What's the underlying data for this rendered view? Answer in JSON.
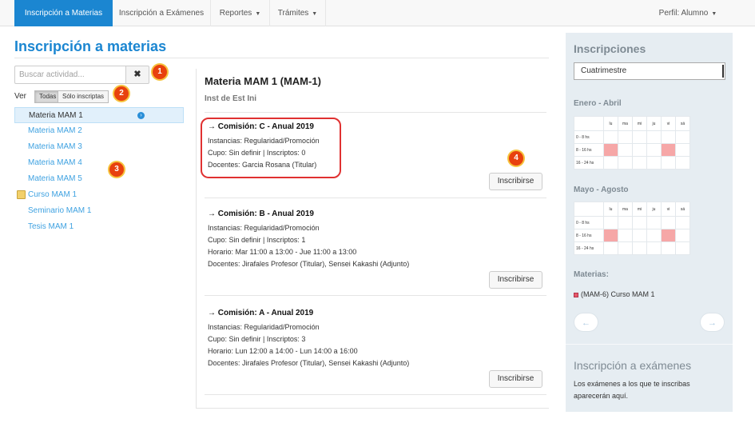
{
  "navbar": {
    "tabs": [
      {
        "label": "Inscripción a Materias",
        "active": true
      },
      {
        "label": "Inscripción a Exámenes"
      },
      {
        "label": "Reportes"
      },
      {
        "label": "Trámites"
      }
    ],
    "profile": "Perfil: Alumno"
  },
  "page_title": "Inscripción a materias",
  "search": {
    "placeholder": "Buscar actividad...",
    "value": ""
  },
  "clear_icon": "✖",
  "filter": {
    "label": "Ver",
    "options": [
      "Todas",
      "Sólo inscriptas"
    ],
    "selected": "Todas"
  },
  "badges": [
    "1",
    "2",
    "3",
    "4"
  ],
  "activities": [
    {
      "label": "Materia MAM 1",
      "selected": true,
      "icon": "info-icon"
    },
    {
      "label": "Materia MAM 2"
    },
    {
      "label": "Materia MAM 3"
    },
    {
      "label": "Materia MAM 4"
    },
    {
      "label": "Materia MAM 5"
    },
    {
      "label": "Curso MAM 1",
      "icon": "pencil-icon"
    },
    {
      "label": "Seminario MAM 1"
    },
    {
      "label": "Tesis MAM 1"
    }
  ],
  "materia": {
    "title": "Materia MAM 1 (MAM-1)",
    "subtitle": "Inst de Est Ini",
    "comisiones": [
      {
        "title": "→ Comisión: C - Anual 2019",
        "lines": [
          "Instancias: Regularidad/Promoción",
          "Cupo: Sin definir | Inscriptos: 0",
          "Docentes: Garcia Rosana (Titular)"
        ],
        "button": "Inscribirse"
      },
      {
        "title": "→ Comisión: B - Anual 2019",
        "lines": [
          "Instancias: Regularidad/Promoción",
          "Cupo: Sin definir | Inscriptos: 1",
          "Horario: Mar 11:00 a 13:00 - Jue 11:00 a 13:00",
          "Docentes: Jirafales Profesor (Titular), Sensei Kakashi (Adjunto)"
        ],
        "button": "Inscribirse"
      },
      {
        "title": "→ Comisión: A - Anual 2019",
        "lines": [
          "Instancias: Regularidad/Promoción",
          "Cupo: Sin definir | Inscriptos: 3",
          "Horario: Lun 12:00 a 14:00 - Lun 14:00 a 16:00",
          "Docentes: Jirafales Profesor (Titular), Sensei Kakashi (Adjunto)"
        ],
        "button": "Inscribirse"
      }
    ]
  },
  "sidebar": {
    "title": "Inscripciones",
    "period_select": "Cuatrimestre",
    "days": [
      "lu",
      "ma",
      "mi",
      "ju",
      "vi",
      "sá"
    ],
    "slots": [
      "0 - 8 hs",
      "8 - 16 hs",
      "16 - 24 hs"
    ],
    "periods": [
      {
        "label": "Enero - Abril",
        "busy": [
          [
            1,
            0
          ],
          [
            1,
            4
          ]
        ]
      },
      {
        "label": "Mayo - Agosto",
        "busy": [
          [
            1,
            0
          ],
          [
            1,
            4
          ]
        ]
      }
    ],
    "materias_label": "Materias:",
    "legend_item": "(MAM-6) Curso MAM 1",
    "legend_color": "#e55a6a",
    "prev": "←",
    "next": "→",
    "exams_title": "Inscripción a exámenes",
    "exams_text": "Los exámenes a los que te inscribas aparecerán aquí."
  },
  "colors": {
    "accent": "#1b86d1",
    "link": "#3fa2e1",
    "badge": "#e8410e",
    "highlight": "#e03131",
    "busy": "#f6a7a7"
  }
}
